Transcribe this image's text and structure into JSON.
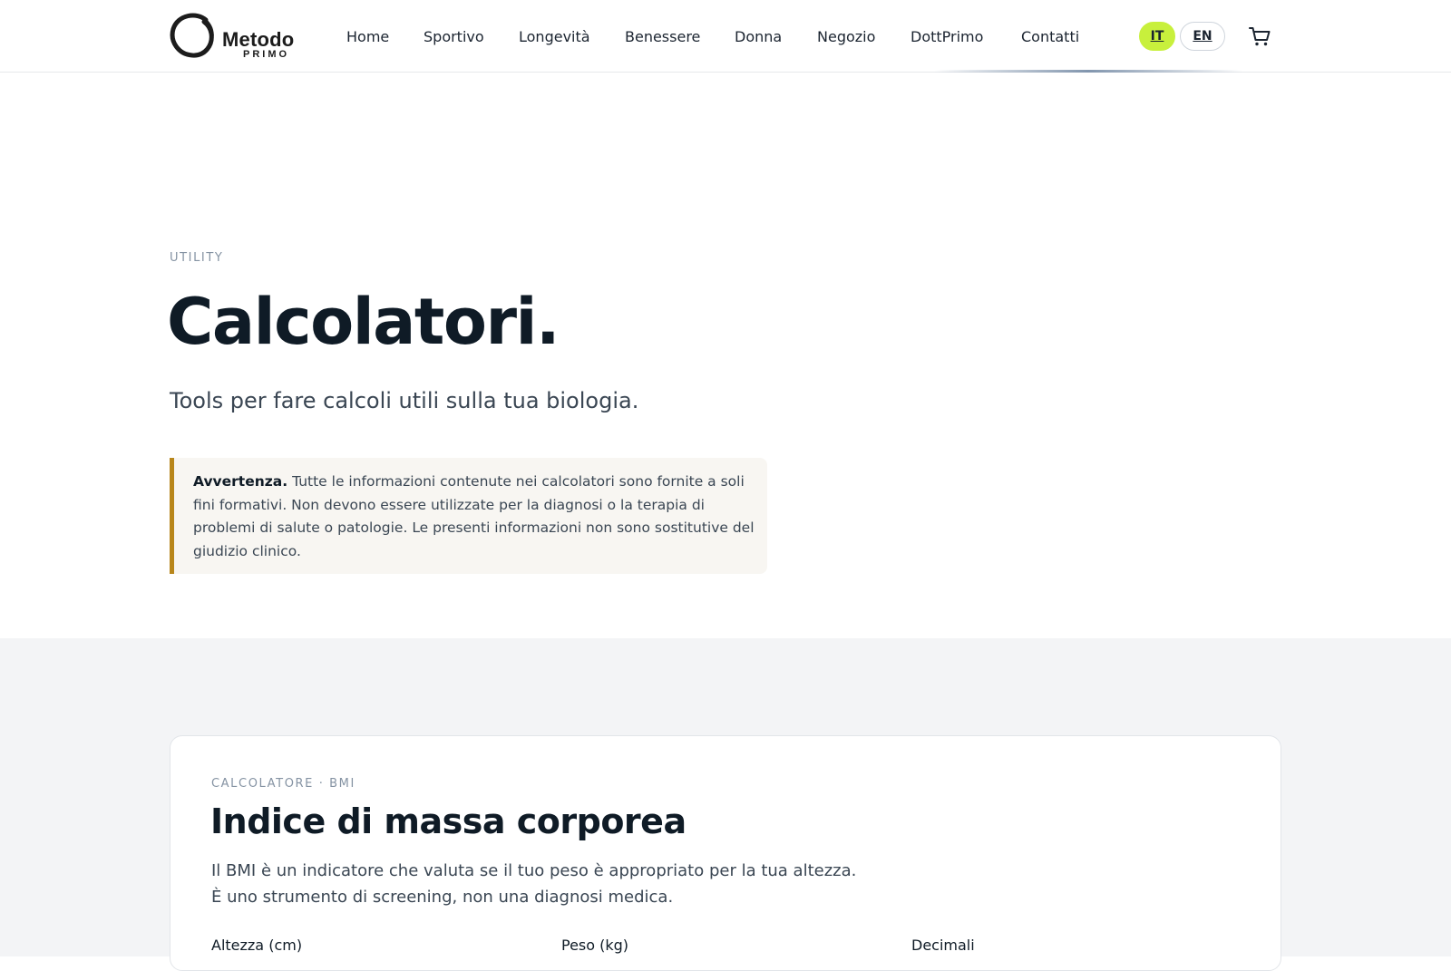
{
  "header": {
    "logo": {
      "word": "Metodo",
      "sub": "PRIMO"
    },
    "nav": [
      {
        "label": "Home"
      },
      {
        "label": "Sportivo"
      },
      {
        "label": "Longevità"
      },
      {
        "label": "Benessere"
      },
      {
        "label": "Donna"
      },
      {
        "label": "Negozio"
      },
      {
        "label": "DottPrimo"
      },
      {
        "label": "Contatti"
      }
    ],
    "languages": {
      "it": "IT",
      "en": "EN",
      "active": "IT"
    },
    "cart_icon": "cart-icon",
    "accent_color": "#c8f03c"
  },
  "hero": {
    "eyebrow": "UTILITY",
    "title": "Calcolatori.",
    "subtitle": "Tools per fare calcoli utili sulla tua biologia.",
    "warning": {
      "bold": "Avvertenza.",
      "text": "Tutte le informazioni contenute nei calcolatori sono fornite a soli fini formativi. Non devono essere utilizzate per la diagnosi o la terapia di problemi di salute o patologie. Le presenti informazioni non sono sostitutive del giudizio clinico.",
      "border_color": "#b8861b"
    }
  },
  "bmi_card": {
    "eyebrow": "CALCOLATORE · BMI",
    "title": "Indice di massa corporea",
    "description": "Il BMI è un indicatore che valuta se il tuo peso è appropriato per la tua altezza. È uno strumento di screening, non una diagnosi medica.",
    "fields": [
      {
        "label": "Altezza (cm)"
      },
      {
        "label": "Peso (kg)"
      },
      {
        "label": "Decimali"
      }
    ]
  }
}
